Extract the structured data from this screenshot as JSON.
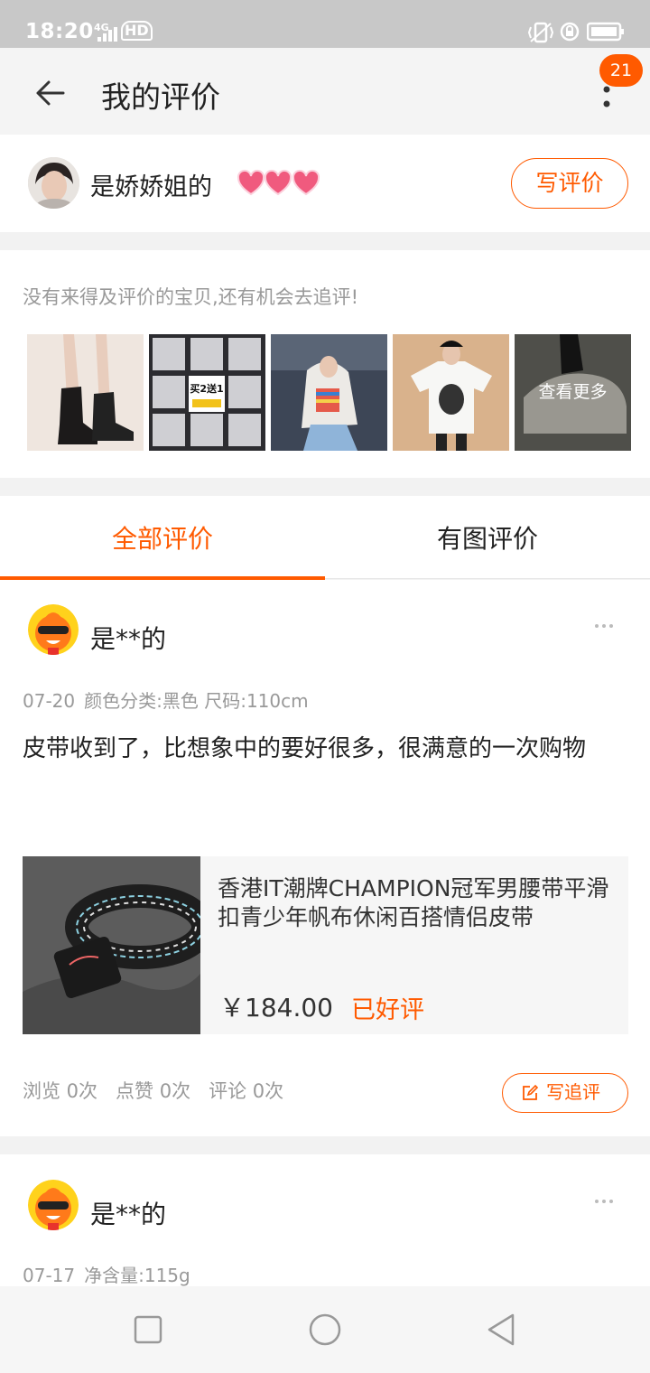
{
  "status_bar": {
    "time": "18:20",
    "network": "4G",
    "hd": "HD"
  },
  "header": {
    "title": "我的评价",
    "badge_count": "21",
    "icons": [
      "back-arrow-icon",
      "more-vertical-icon"
    ]
  },
  "user": {
    "name": "是娇娇姐的",
    "level_icon": "hearts-rank-icon",
    "write_review_label": "写评价"
  },
  "pending": {
    "hint": "没有来得及评价的宝贝,还有机会去追评!",
    "thumb_text": "买2送1",
    "see_more_label": "查看更多"
  },
  "tabs": [
    {
      "label": "全部评价",
      "active": true
    },
    {
      "label": "有图评价",
      "active": false
    }
  ],
  "reviews": [
    {
      "user": "是**的",
      "date": "07-20",
      "spec": "颜色分类:黑色 尺码:110cm",
      "text": "皮带收到了，比想象中的要好很多，很满意的一次购物",
      "product": {
        "title": "香港IT潮牌CHAMPION冠军男腰带平滑扣青少年帆布休闲百搭情侣皮带",
        "price": "￥184.00",
        "status": "已好评"
      },
      "stats": {
        "views": "浏览 0次",
        "likes": "点赞 0次",
        "comments": "评论 0次"
      },
      "followup_label": "写追评"
    },
    {
      "user": "是**的",
      "date": "07-17",
      "spec": "净含量:115g"
    }
  ],
  "colors": {
    "accent": "#ff5a00",
    "muted_text": "#999999",
    "background": "#f2f2f2"
  }
}
